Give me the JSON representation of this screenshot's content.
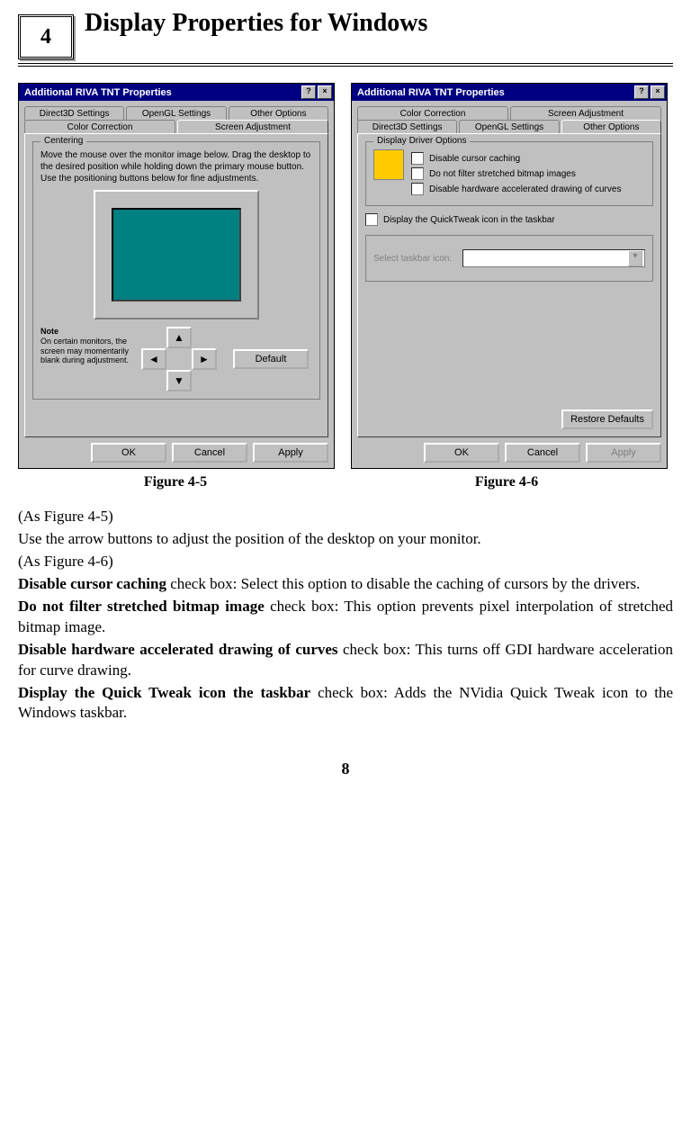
{
  "header": {
    "chapter_number": "4",
    "page_title": "Display Properties for Windows"
  },
  "dialog_left": {
    "title": "Additional RIVA TNT Properties",
    "tabs_row1": [
      "Direct3D Settings",
      "OpenGL Settings",
      "Other Options"
    ],
    "tabs_row2": [
      "Color Correction",
      "Screen Adjustment"
    ],
    "group_label": "Centering",
    "instructions": "Move the mouse over the monitor image below. Drag the desktop to the desired position while holding down the primary mouse button. Use the positioning buttons below for fine adjustments.",
    "note_label": "Note",
    "note_text": "On certain monitors, the screen may momentarily blank during adjustment.",
    "default_btn": "Default",
    "ok": "OK",
    "cancel": "Cancel",
    "apply": "Apply"
  },
  "dialog_right": {
    "title": "Additional RIVA TNT Properties",
    "tabs_row1": [
      "Color Correction",
      "Screen Adjustment"
    ],
    "tabs_row2": [
      "Direct3D Settings",
      "OpenGL Settings",
      "Other Options"
    ],
    "group_label": "Display Driver Options",
    "chk1": "Disable cursor caching",
    "chk2": "Do not filter stretched bitmap images",
    "chk3": "Disable hardware accelerated drawing of curves",
    "chk4": "Display the QuickTweak icon in the taskbar",
    "select_label": "Select taskbar icon:",
    "restore_btn": "Restore Defaults",
    "ok": "OK",
    "cancel": "Cancel",
    "apply": "Apply"
  },
  "captions": {
    "fig45": "Figure 4-5",
    "fig46": "Figure 4-6"
  },
  "body": {
    "p1": "(As Figure 4-5)",
    "p2": "Use the arrow buttons to adjust the position of the desktop on your monitor.",
    "p3": "(As Figure 4-6)",
    "p4a": "Disable cursor caching",
    "p4b": " check box: Select this option to disable the caching of cursors by the drivers.",
    "p5a": "Do not filter stretched bitmap image",
    "p5b": " check box: This option prevents pixel interpolation of stretched bitmap image.",
    "p6a": "Disable hardware accelerated drawing of curves",
    "p6b": " check box: This turns off GDI hardware acceleration for curve drawing.",
    "p7a": "Display the Quick Tweak icon the taskbar",
    "p7b": " check box: Adds the NVidia Quick Tweak icon to the Windows taskbar."
  },
  "page_number": "8"
}
